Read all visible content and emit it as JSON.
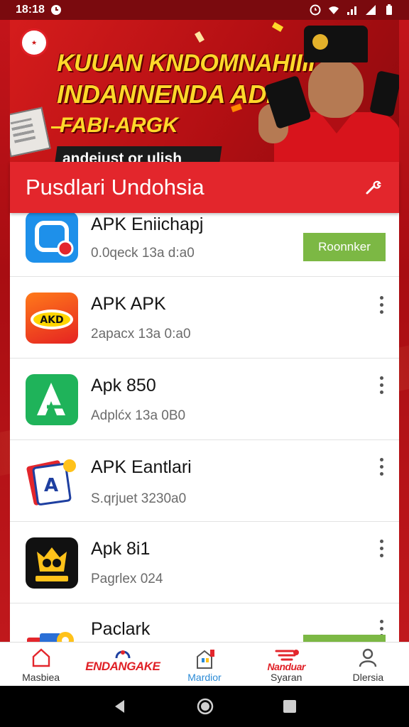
{
  "status_bar": {
    "time": "18:18",
    "icons": [
      "alarm-icon",
      "wifi-icon",
      "signal-icon",
      "battery-icon"
    ]
  },
  "banner": {
    "line1": "KUUAN KNDOMNAHIIII",
    "line2": "INDANNENDA ADN",
    "line3": "FABI-ARGK",
    "pill_text": "andejust or ulish",
    "colors": {
      "headline": "#ffd82a",
      "background": "#c3141a"
    }
  },
  "panel": {
    "title": "Pusdlari Undohsia",
    "action_icon": "wrench-icon"
  },
  "apps": [
    {
      "name": "APK Eniichapj",
      "meta": "0.0qeck 13a d:a0",
      "action": "button",
      "button_label": "Roonnker",
      "icon": "chat-bubble-icon"
    },
    {
      "name": "APK APK",
      "meta": "2apacx 13a 0:a0",
      "action": "menu",
      "icon": "racing-badge-icon"
    },
    {
      "name": "Apk 850",
      "meta": "Adplćx 13a 0B0",
      "action": "menu",
      "icon": "letter-a-icon"
    },
    {
      "name": "APK Eantlari",
      "meta": "S.qrjuet 3230a0",
      "action": "menu",
      "icon": "cards-icon"
    },
    {
      "name": "Apk 8i1",
      "meta": "Pagrlex 024",
      "action": "menu",
      "icon": "owl-icon"
    },
    {
      "name": "Paclark",
      "meta": "",
      "action": "menu",
      "icon": "gear-bundle-icon"
    }
  ],
  "bottom_nav": [
    {
      "label": "Masbiea",
      "icon": "home-icon"
    },
    {
      "label": "",
      "brand": "ENDANGAKE",
      "icon": "brand-logo-icon"
    },
    {
      "label": "Mardior",
      "icon": "city-icon",
      "active": true
    },
    {
      "label": "Syaran",
      "brand": "Nanduar",
      "icon": "share-lines-icon"
    },
    {
      "label": "Dlersia",
      "icon": "person-icon"
    }
  ],
  "system_nav": [
    "back-icon",
    "home-circle-icon",
    "recents-icon"
  ]
}
